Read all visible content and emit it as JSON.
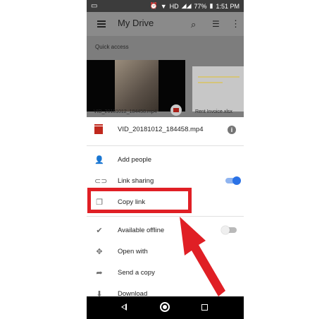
{
  "statusbar": {
    "right_text": "77%",
    "time": "1:51 PM",
    "network": "HD"
  },
  "appbar": {
    "title": "My Drive"
  },
  "quick_access": {
    "label": "Quick access",
    "items": [
      {
        "name": "VID_20181012_184458.mp4"
      },
      {
        "name": "Rent Invoice.xlsx"
      }
    ]
  },
  "sheet": {
    "file_name": "VID_20181012_184458.mp4",
    "items": [
      {
        "label": "Add people",
        "icon": "add-person-icon"
      },
      {
        "label": "Link sharing",
        "icon": "link-icon",
        "toggle": true
      },
      {
        "label": "Copy link",
        "icon": "copy-icon"
      },
      {
        "label": "Available offline",
        "icon": "offline-check-icon",
        "toggle": false
      },
      {
        "label": "Open with",
        "icon": "open-with-icon"
      },
      {
        "label": "Send a copy",
        "icon": "share-arrow-icon"
      },
      {
        "label": "Download",
        "icon": "download-icon"
      }
    ]
  },
  "colors": {
    "highlight": "#e01f25",
    "toggle_on": "#2b72e6",
    "file_icon": "#c0281d"
  }
}
